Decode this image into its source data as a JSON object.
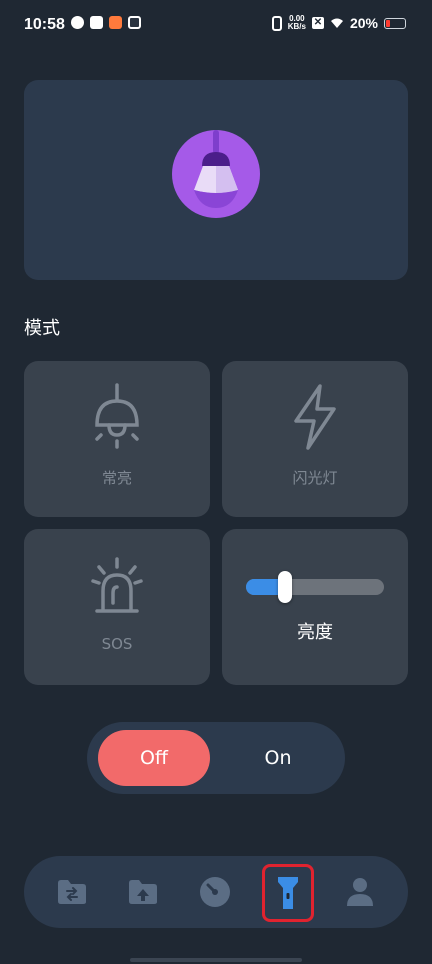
{
  "status_bar": {
    "time": "10:58",
    "net_speed_value": "0.00",
    "net_speed_unit": "KB/s",
    "battery_percent": "20%"
  },
  "hero": {
    "icon": "light-bulb-icon"
  },
  "section": {
    "title": "模式"
  },
  "modes": [
    {
      "label": "常亮",
      "icon": "ceiling-lamp-icon"
    },
    {
      "label": "闪光灯",
      "icon": "lightning-bolt-icon"
    },
    {
      "label": "SOS",
      "icon": "alarm-siren-icon"
    }
  ],
  "brightness": {
    "label": "亮度",
    "level": 0.28
  },
  "power_toggle": {
    "off_label": "Off",
    "on_label": "On",
    "state": "off"
  },
  "bottom_nav": {
    "items": [
      {
        "icon": "folder-transfer-icon"
      },
      {
        "icon": "folder-upload-icon"
      },
      {
        "icon": "gauge-icon"
      },
      {
        "icon": "flashlight-icon",
        "active": true
      },
      {
        "icon": "person-icon"
      }
    ]
  },
  "colors": {
    "background": "#1f2833",
    "card": "#39424d",
    "panel": "#2c3a4d",
    "accent_red": "#f26a6a",
    "accent_blue": "#3b8de6",
    "bulb_purple": "#a55ae8"
  }
}
